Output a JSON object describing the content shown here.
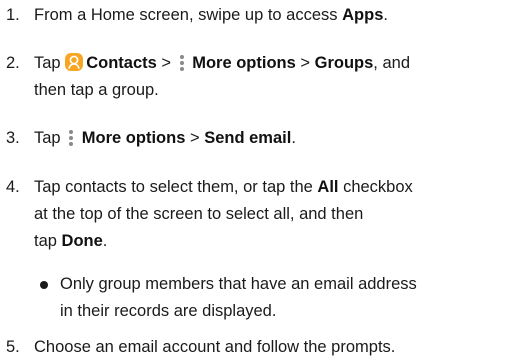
{
  "steps": [
    {
      "number": "1.",
      "line1_pre": "From a Home screen, swipe up to access ",
      "line1_bold": "Apps",
      "line1_post": "."
    },
    {
      "number": "2.",
      "tap": "Tap",
      "contacts": "Contacts",
      "sep1": ">",
      "more_options": "More options",
      "sep2": ">",
      "groups": "Groups",
      "line1_post": ", and",
      "line2": "then tap a group."
    },
    {
      "number": "3.",
      "tap": "Tap",
      "more_options": "More options",
      "sep": ">",
      "send_email": "Send email",
      "post": "."
    },
    {
      "number": "4.",
      "line1_pre": "Tap contacts to select them, or tap the ",
      "all": "All",
      "line1_post": " checkbox",
      "line2": "at the top of the screen to select all, and then",
      "line3_pre": "tap ",
      "done": "Done",
      "line3_post": "."
    },
    {
      "number": "5.",
      "line1": "Choose an email account and follow the prompts."
    }
  ],
  "note": {
    "line1": "Only group members that have an email address",
    "line2": "in their records are displayed."
  },
  "icons": {
    "contacts_app": "contacts-app-icon",
    "more_options": "more-options-icon",
    "bullet": "bullet-dot"
  },
  "colors": {
    "contacts_icon_bg": "#f6a623",
    "text": "#1a1a1a"
  }
}
